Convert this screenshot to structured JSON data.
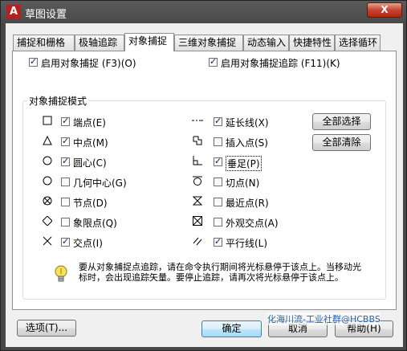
{
  "window": {
    "title": "草图设置",
    "app_letter": "A",
    "close_glyph": "X"
  },
  "tabs": [
    "捕捉和栅格",
    "极轴追踪",
    "对象捕捉",
    "三维对象捕捉",
    "动态输入",
    "快捷特性",
    "选择循环"
  ],
  "top_options": {
    "enable_osnap": {
      "label": "启用对象捕捉 (F3)(O)",
      "checked": true
    },
    "enable_tracking": {
      "label": "启用对象捕捉追踪 (F11)(K)",
      "checked": true
    }
  },
  "group_title": "对象捕捉模式",
  "snap_modes_left": [
    {
      "symbol": "square",
      "label": "端点(E)",
      "checked": true
    },
    {
      "symbol": "triangle",
      "label": "中点(M)",
      "checked": true
    },
    {
      "symbol": "circle",
      "label": "圆心(C)",
      "checked": true
    },
    {
      "symbol": "circle",
      "label": "几何中心(G)",
      "checked": false
    },
    {
      "symbol": "node",
      "label": "节点(D)",
      "checked": false
    },
    {
      "symbol": "diamond",
      "label": "象限点(Q)",
      "checked": false
    },
    {
      "symbol": "cross",
      "label": "交点(I)",
      "checked": true
    }
  ],
  "snap_modes_right": [
    {
      "symbol": "extension",
      "label": "延长线(X)",
      "checked": true
    },
    {
      "symbol": "insertion",
      "label": "插入点(S)",
      "checked": false
    },
    {
      "symbol": "perpendicular",
      "label": "垂足(P)",
      "checked": true
    },
    {
      "symbol": "tangent",
      "label": "切点(N)",
      "checked": false
    },
    {
      "symbol": "nearest",
      "label": "最近点(R)",
      "checked": false
    },
    {
      "symbol": "apparent",
      "label": "外观交点(A)",
      "checked": false
    },
    {
      "symbol": "parallel",
      "label": "平行线(L)",
      "checked": true
    }
  ],
  "buttons": {
    "select_all": "全部选择",
    "clear_all": "全部清除",
    "options": "选项(T)...",
    "ok": "确定",
    "cancel": "取消",
    "help": "帮助(H)"
  },
  "tip_text": "要从对象捕捉点追踪，请在命令执行期间将光标悬停于该点上。当移动光标时，会出现追踪矢量。要停止追踪，请再次将光标悬停于该点上。",
  "watermark": "化海川流-工业社群@HCBBS"
}
